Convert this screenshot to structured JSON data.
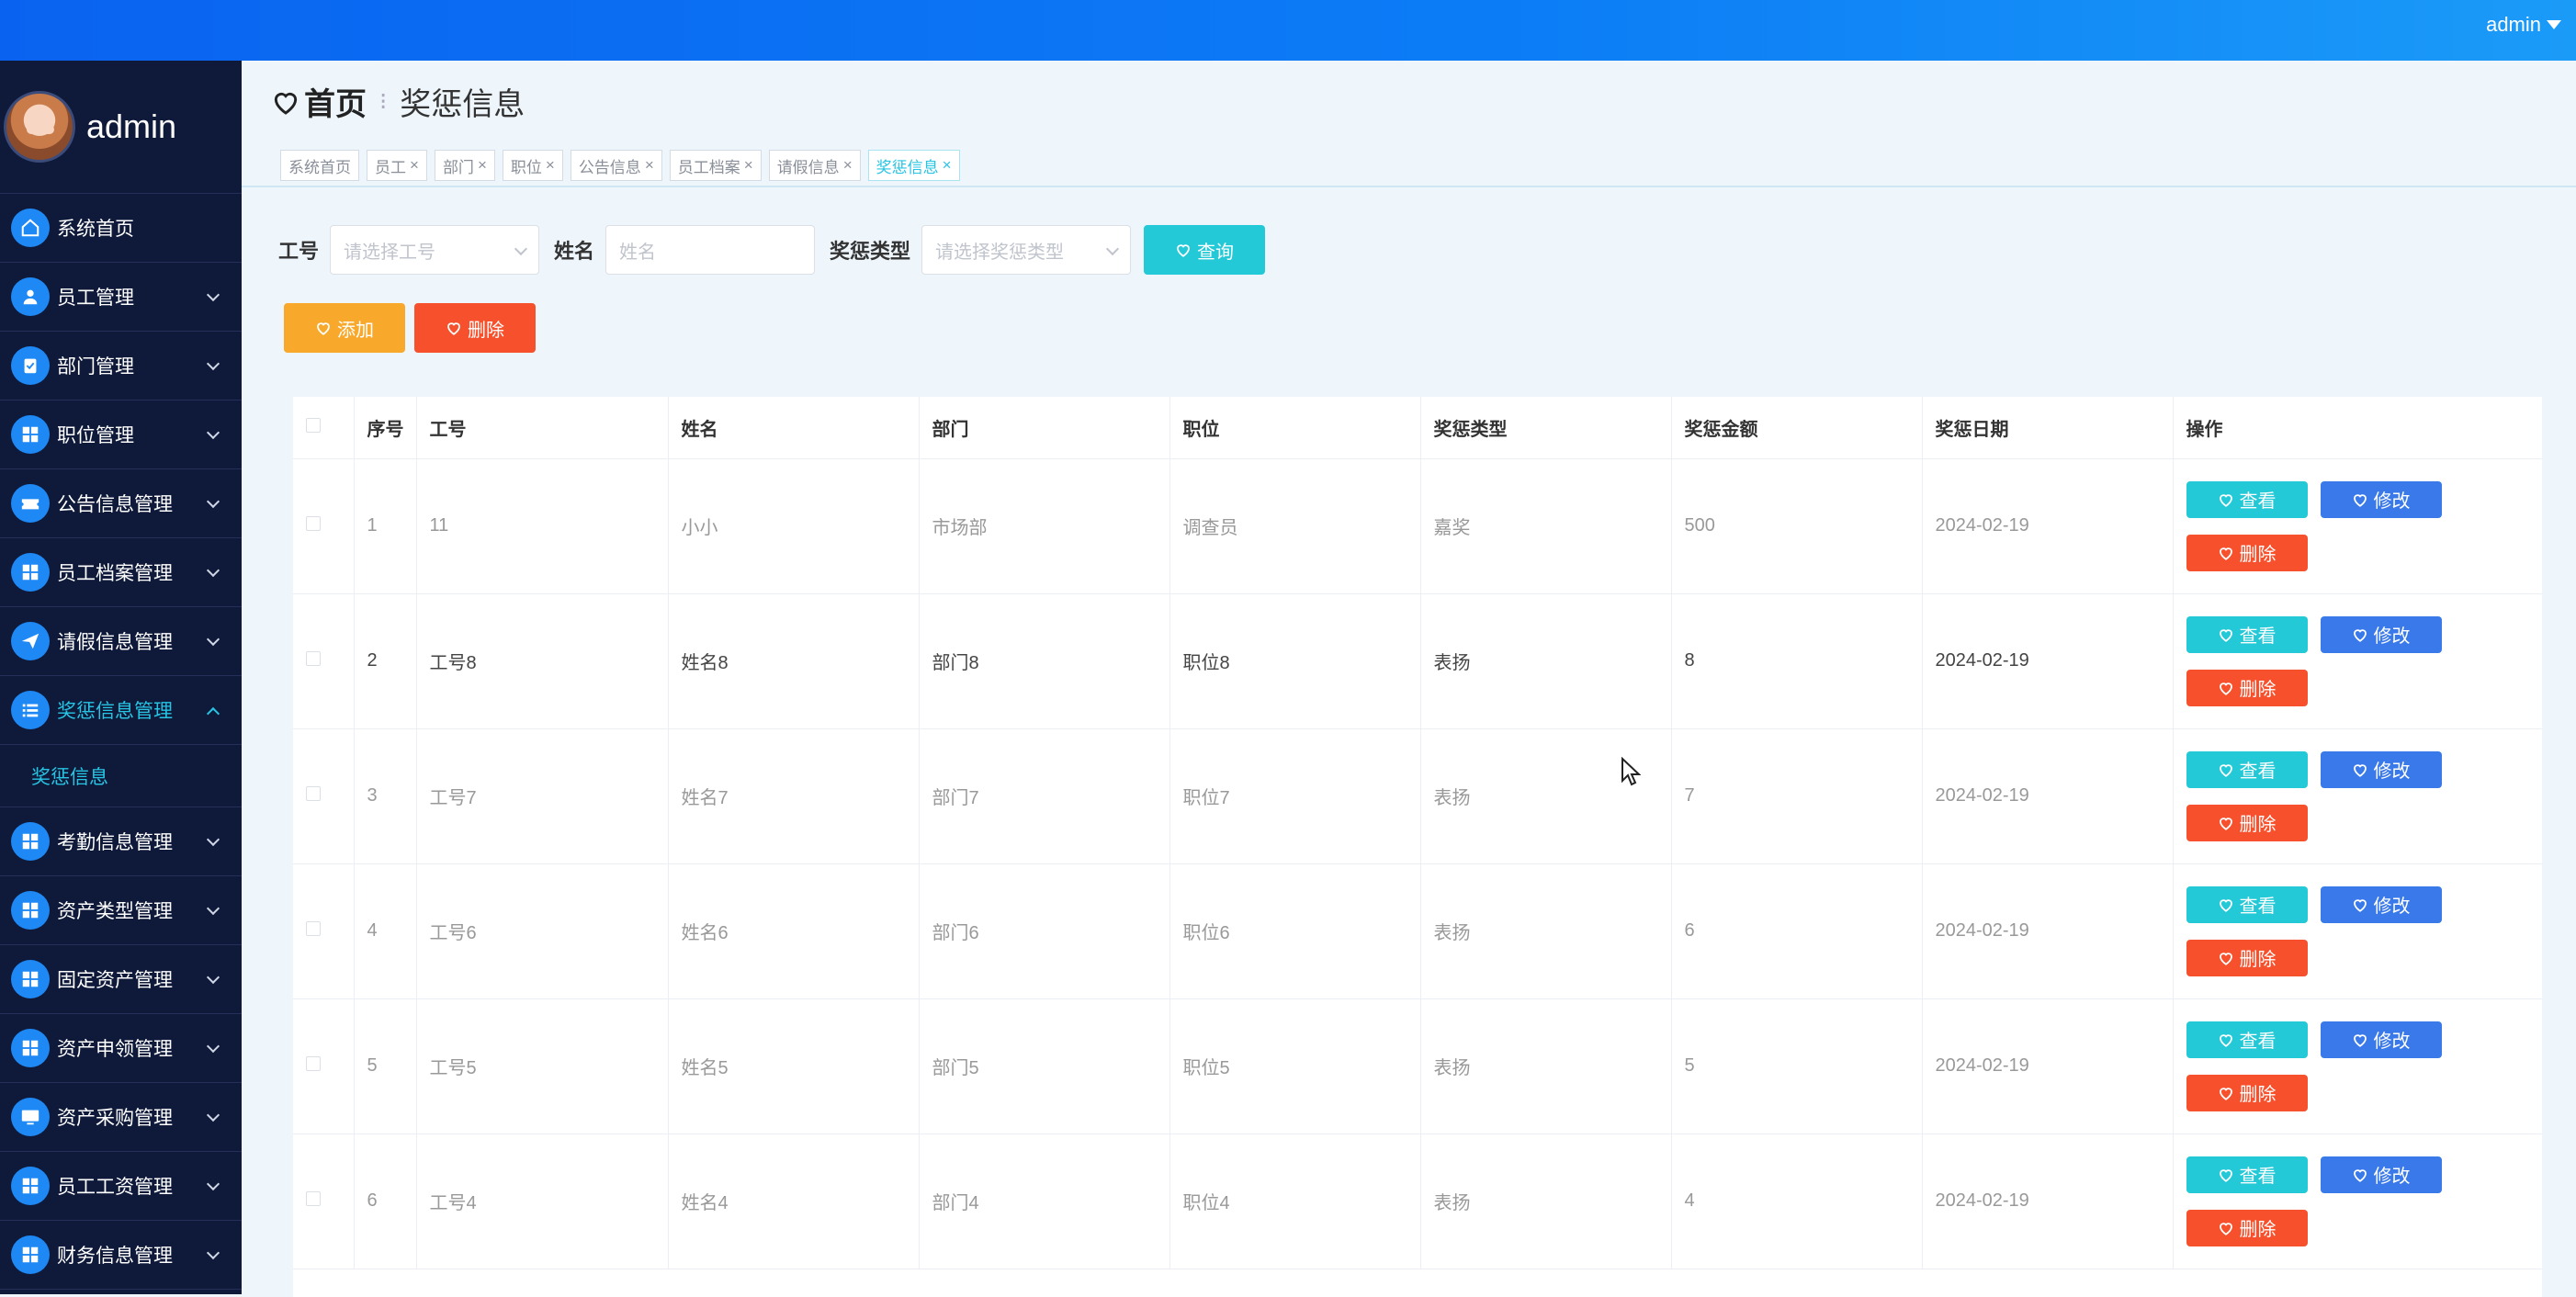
{
  "topbar": {
    "user": "admin"
  },
  "sidebar": {
    "username": "admin",
    "items": [
      {
        "label": "系统首页",
        "icon": "home-icon"
      },
      {
        "label": "员工管理",
        "icon": "user-icon"
      },
      {
        "label": "部门管理",
        "icon": "clipboard-icon"
      },
      {
        "label": "职位管理",
        "icon": "grid-icon"
      },
      {
        "label": "公告信息管理",
        "icon": "ticket-icon"
      },
      {
        "label": "员工档案管理",
        "icon": "grid-icon"
      },
      {
        "label": "请假信息管理",
        "icon": "send-icon"
      },
      {
        "label": "奖惩信息管理",
        "icon": "list-icon"
      },
      {
        "label": "考勤信息管理",
        "icon": "grid-icon"
      },
      {
        "label": "资产类型管理",
        "icon": "grid-icon"
      },
      {
        "label": "固定资产管理",
        "icon": "grid-icon"
      },
      {
        "label": "资产申领管理",
        "icon": "grid-icon"
      },
      {
        "label": "资产采购管理",
        "icon": "monitor-icon"
      },
      {
        "label": "员工工资管理",
        "icon": "grid-icon"
      },
      {
        "label": "财务信息管理",
        "icon": "grid-icon"
      }
    ],
    "submenu_label": "奖惩信息"
  },
  "breadcrumb": {
    "home": "首页",
    "current": "奖惩信息"
  },
  "tabs": [
    "系统首页",
    "员工",
    "部门",
    "职位",
    "公告信息",
    "员工档案",
    "请假信息",
    "奖惩信息"
  ],
  "search": {
    "emp_no_label": "工号",
    "emp_no_placeholder": "请选择工号",
    "name_label": "姓名",
    "name_placeholder": "姓名",
    "type_label": "奖惩类型",
    "type_placeholder": "请选择奖惩类型",
    "query_button": "查询"
  },
  "toolbar": {
    "add_label": "添加",
    "delete_label": "删除"
  },
  "table": {
    "headers": [
      "序号",
      "工号",
      "姓名",
      "部门",
      "职位",
      "奖惩类型",
      "奖惩金额",
      "奖惩日期",
      "操作"
    ],
    "rows": [
      {
        "seq": "1",
        "emp_no": "11",
        "name": "小小",
        "dept": "市场部",
        "pos": "调查员",
        "type": "嘉奖",
        "amount": "500",
        "date": "2024-02-19"
      },
      {
        "seq": "2",
        "emp_no": "工号8",
        "name": "姓名8",
        "dept": "部门8",
        "pos": "职位8",
        "type": "表扬",
        "amount": "8",
        "date": "2024-02-19"
      },
      {
        "seq": "3",
        "emp_no": "工号7",
        "name": "姓名7",
        "dept": "部门7",
        "pos": "职位7",
        "type": "表扬",
        "amount": "7",
        "date": "2024-02-19"
      },
      {
        "seq": "4",
        "emp_no": "工号6",
        "name": "姓名6",
        "dept": "部门6",
        "pos": "职位6",
        "type": "表扬",
        "amount": "6",
        "date": "2024-02-19"
      },
      {
        "seq": "5",
        "emp_no": "工号5",
        "name": "姓名5",
        "dept": "部门5",
        "pos": "职位5",
        "type": "表扬",
        "amount": "5",
        "date": "2024-02-19"
      },
      {
        "seq": "6",
        "emp_no": "工号4",
        "name": "姓名4",
        "dept": "部门4",
        "pos": "职位4",
        "type": "表扬",
        "amount": "4",
        "date": "2024-02-19"
      }
    ],
    "view_label": "查看",
    "edit_label": "修改",
    "delete_label": "删除"
  }
}
